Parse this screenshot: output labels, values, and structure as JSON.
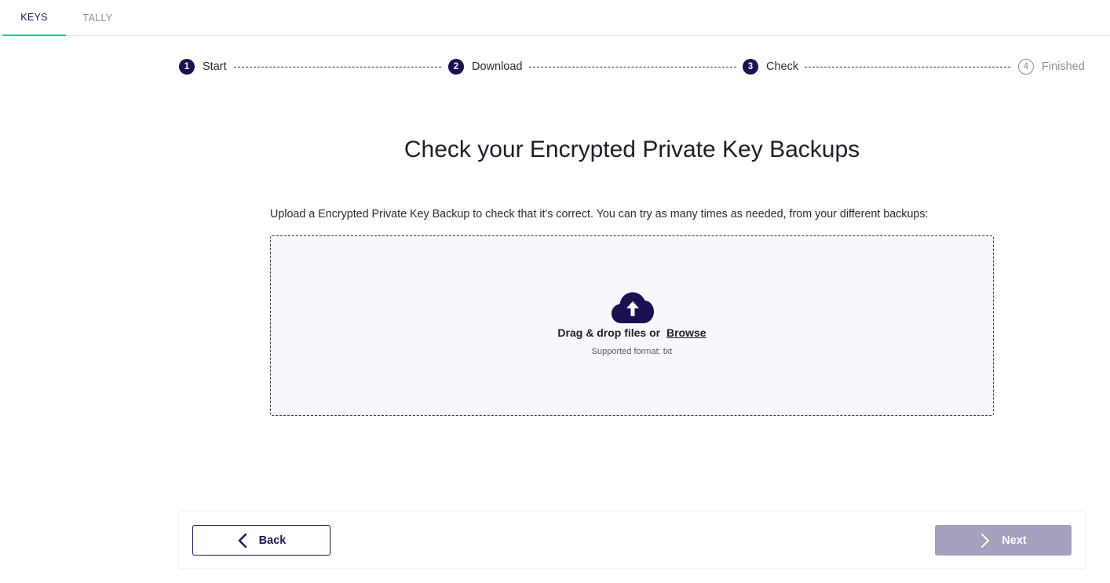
{
  "tabs": [
    {
      "label": "KEYS",
      "active": true
    },
    {
      "label": "TALLY",
      "active": false
    }
  ],
  "stepper": {
    "steps": [
      {
        "number": "1",
        "label": "Start",
        "state": "done"
      },
      {
        "number": "2",
        "label": "Download",
        "state": "done"
      },
      {
        "number": "3",
        "label": "Check",
        "state": "current"
      },
      {
        "number": "4",
        "label": "Finished",
        "state": "pending"
      }
    ]
  },
  "main": {
    "title": "Check your Encrypted Private Key Backups",
    "instructions": "Upload a Encrypted Private Key Backup to check that it's correct. You can try as many times as needed, from your different backups:",
    "dropzone": {
      "icon": "cloud-upload-icon",
      "prompt": "Drag & drop files or",
      "browse_label": "Browse",
      "format_note": "Supported format: txt"
    }
  },
  "footer": {
    "back_label": "Back",
    "back_icon": "chevron-left-icon",
    "next_label": "Next",
    "next_icon": "chevron-right-icon",
    "next_disabled": true
  },
  "colors": {
    "primary": "#1a1150",
    "tab_indicator": "#2fc38f",
    "disabled_button": "#a3a1bd",
    "dropzone_bg": "#f7f8fc"
  }
}
